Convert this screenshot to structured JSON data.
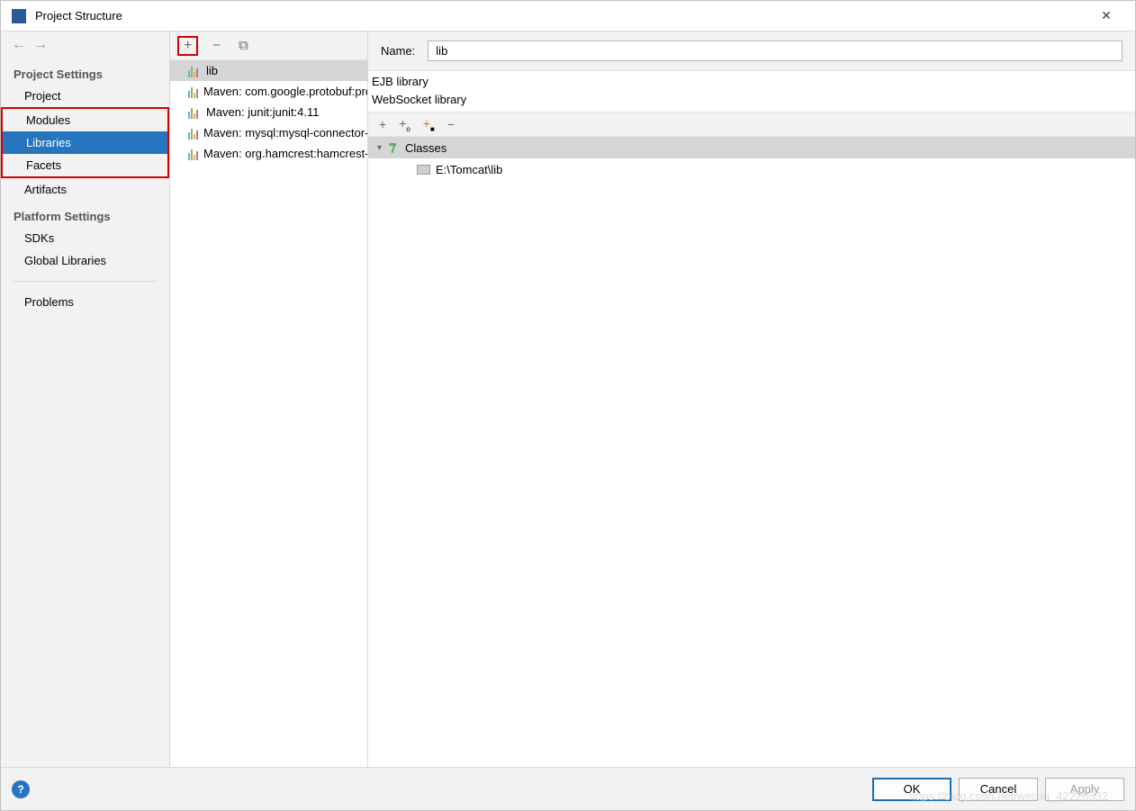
{
  "window": {
    "title": "Project Structure"
  },
  "sidebar": {
    "projectHeading": "Project Settings",
    "platformHeading": "Platform Settings",
    "items": {
      "project": "Project",
      "modules": "Modules",
      "libraries": "Libraries",
      "facets": "Facets",
      "artifacts": "Artifacts",
      "sdks": "SDKs",
      "globalLibs": "Global Libraries",
      "problems": "Problems"
    }
  },
  "libraries": [
    {
      "name": "lib",
      "selected": true
    },
    {
      "name": "Maven: com.google.protobuf:protobuf-java"
    },
    {
      "name": "Maven: junit:junit:4.11"
    },
    {
      "name": "Maven: mysql:mysql-connector-java"
    },
    {
      "name": "Maven: org.hamcrest:hamcrest-core"
    }
  ],
  "form": {
    "nameLabel": "Name:",
    "nameValue": "lib",
    "infoLines": [
      "EJB library",
      "WebSocket library"
    ]
  },
  "tree": {
    "rootLabel": "Classes",
    "childPath": "E:\\Tomcat\\lib"
  },
  "footer": {
    "ok": "OK",
    "cancel": "Cancel",
    "apply": "Apply"
  },
  "watermark": "https://blog.csdn.net/weixin_42220532"
}
